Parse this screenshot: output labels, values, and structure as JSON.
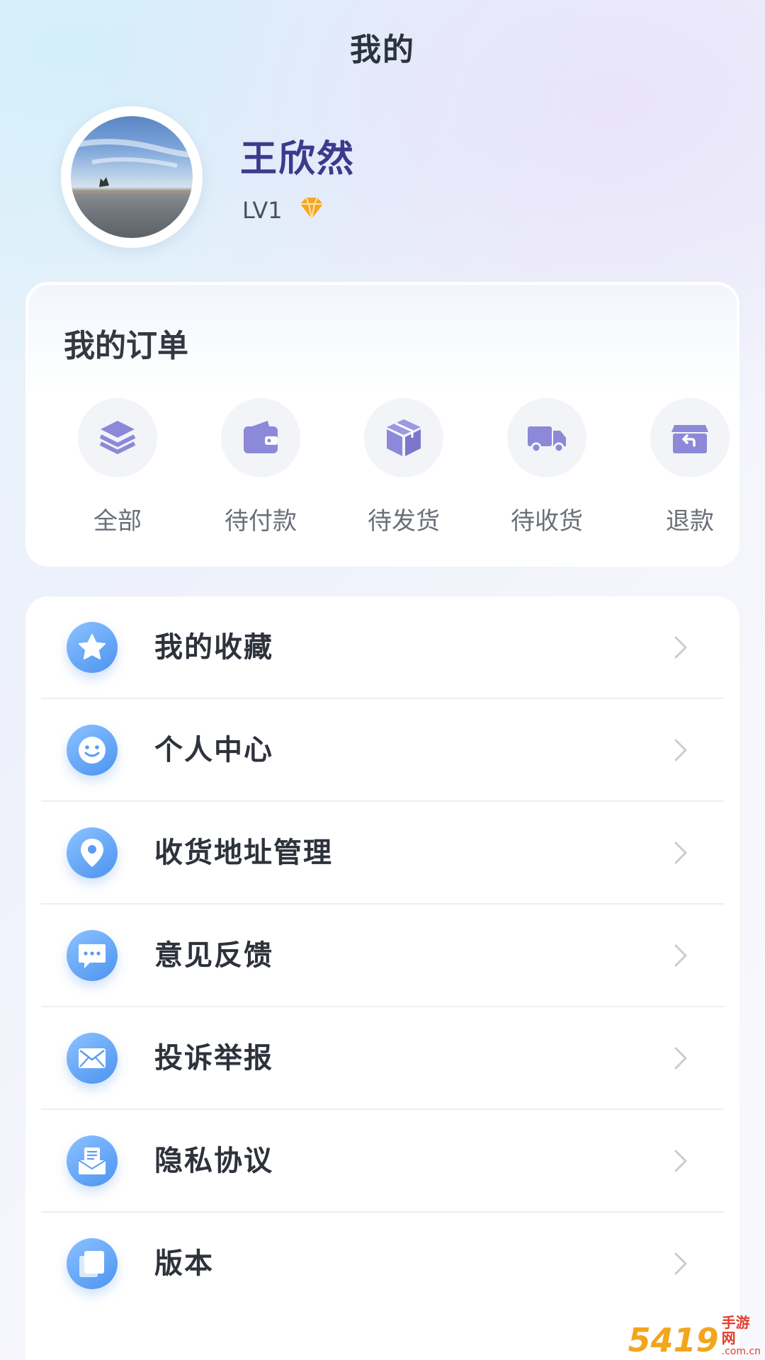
{
  "header": {
    "title": "我的"
  },
  "profile": {
    "name": "王欣然",
    "level": "LV1",
    "level_icon": "diamond-icon",
    "level_color": "#f5a623"
  },
  "orders": {
    "title": "我的订单",
    "accent": "#8c89d8",
    "items": [
      {
        "label": "全部",
        "icon": "layers-icon"
      },
      {
        "label": "待付款",
        "icon": "wallet-icon"
      },
      {
        "label": "待发货",
        "icon": "box-icon"
      },
      {
        "label": "待收货",
        "icon": "truck-icon"
      },
      {
        "label": "退款",
        "icon": "refund-icon"
      }
    ]
  },
  "menu": {
    "icon_color": "#5b9cf2",
    "items": [
      {
        "label": "我的收藏",
        "icon": "star-icon"
      },
      {
        "label": "个人中心",
        "icon": "smiley-icon"
      },
      {
        "label": "收货地址管理",
        "icon": "location-pin-icon"
      },
      {
        "label": "意见反馈",
        "icon": "chat-bubble-icon"
      },
      {
        "label": "投诉举报",
        "icon": "envelope-icon"
      },
      {
        "label": "隐私协议",
        "icon": "document-icon"
      },
      {
        "label": "版本",
        "icon": "pages-icon"
      }
    ]
  },
  "watermark": {
    "main": "5419",
    "top": "手游网",
    "bottom": ".com.cn"
  }
}
